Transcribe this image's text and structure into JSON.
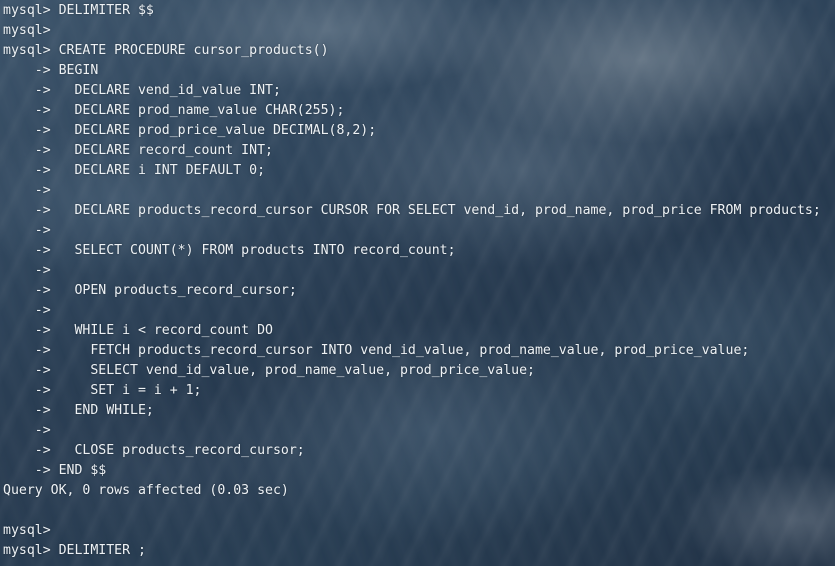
{
  "terminal": {
    "lines": [
      "mysql> DELIMITER $$",
      "mysql>",
      "mysql> CREATE PROCEDURE cursor_products()",
      "    -> BEGIN",
      "    ->   DECLARE vend_id_value INT;",
      "    ->   DECLARE prod_name_value CHAR(255);",
      "    ->   DECLARE prod_price_value DECIMAL(8,2);",
      "    ->   DECLARE record_count INT;",
      "    ->   DECLARE i INT DEFAULT 0;",
      "    ->",
      "    ->   DECLARE products_record_cursor CURSOR FOR SELECT vend_id, prod_name, prod_price FROM products;",
      "    ->",
      "    ->   SELECT COUNT(*) FROM products INTO record_count;",
      "    ->",
      "    ->   OPEN products_record_cursor;",
      "    ->",
      "    ->   WHILE i < record_count DO",
      "    ->     FETCH products_record_cursor INTO vend_id_value, prod_name_value, prod_price_value;",
      "    ->     SELECT vend_id_value, prod_name_value, prod_price_value;",
      "    ->     SET i = i + 1;",
      "    ->   END WHILE;",
      "    ->",
      "    ->   CLOSE products_record_cursor;",
      "    -> END $$",
      "Query OK, 0 rows affected (0.03 sec)",
      "",
      "mysql>",
      "mysql> DELIMITER ;"
    ]
  }
}
